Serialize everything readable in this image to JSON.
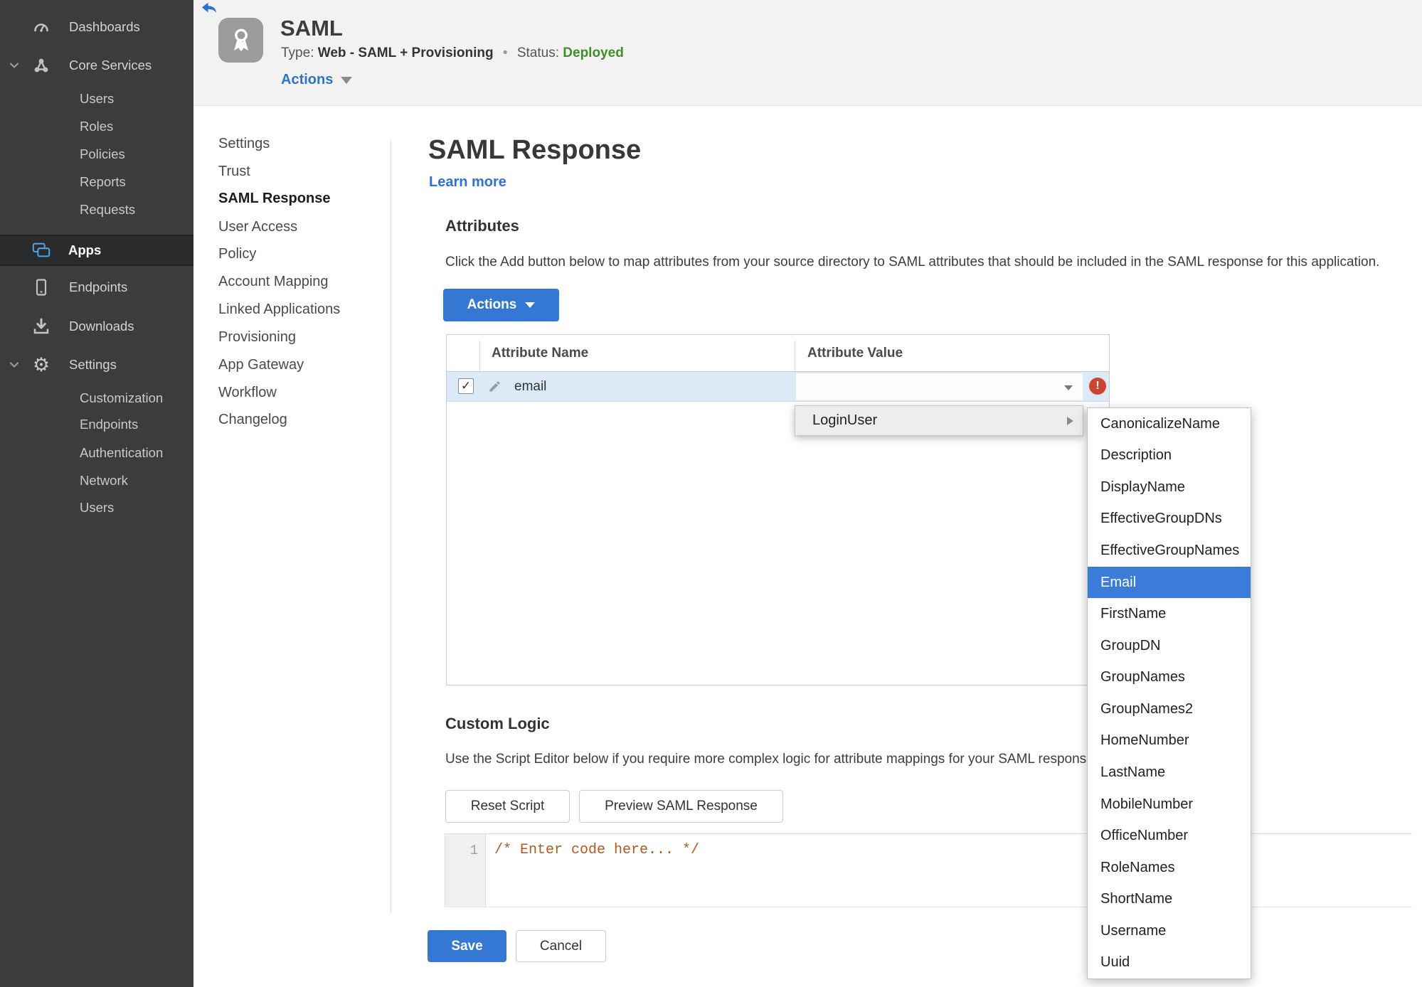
{
  "colors": {
    "accent_blue": "#3478d3",
    "link_blue": "#2e71d8",
    "status_green": "#3f8e27",
    "error_red": "#cb4532",
    "menu_highlight_blue": "#3b7cd9",
    "selected_row_blue": "#dce9f7",
    "sidebar_bg": "#3b3c3d",
    "code_comment_orange": "#b05a20",
    "apps_icon_blue": "#4da3e8"
  },
  "icons": {
    "gear": "⚙",
    "checkmark": "✓",
    "error_mark": "!"
  },
  "sidebar": {
    "items": [
      {
        "label": "Dashboards",
        "icon": "gauge-icon"
      },
      {
        "label": "Core Services",
        "icon": "network-icon",
        "expanded": true
      },
      {
        "label": "Users"
      },
      {
        "label": "Roles"
      },
      {
        "label": "Policies"
      },
      {
        "label": "Reports"
      },
      {
        "label": "Requests"
      },
      {
        "label": "Apps",
        "icon": "apps-icon",
        "active": true
      },
      {
        "label": "Endpoints",
        "icon": "tablet-icon"
      },
      {
        "label": "Downloads",
        "icon": "download-icon"
      },
      {
        "label": "Settings",
        "icon": "gear-icon",
        "expanded": true
      },
      {
        "label": "Customization"
      },
      {
        "label": "Endpoints"
      },
      {
        "label": "Authentication"
      },
      {
        "label": "Network"
      },
      {
        "label": "Users"
      }
    ]
  },
  "header": {
    "app_title": "SAML",
    "type_label": "Type:",
    "type_value": "Web - SAML + Provisioning",
    "bullet": "•",
    "status_label": "Status:",
    "status_value": "Deployed",
    "actions_label": "Actions"
  },
  "subnav": {
    "items": [
      {
        "label": "Settings"
      },
      {
        "label": "Trust"
      },
      {
        "label": "SAML Response",
        "active": true
      },
      {
        "label": "User Access"
      },
      {
        "label": "Policy"
      },
      {
        "label": "Account Mapping"
      },
      {
        "label": "Linked Applications"
      },
      {
        "label": "Provisioning"
      },
      {
        "label": "App Gateway"
      },
      {
        "label": "Workflow"
      },
      {
        "label": "Changelog"
      }
    ]
  },
  "main": {
    "title": "SAML Response",
    "learn_more": "Learn more",
    "attributes": {
      "heading": "Attributes",
      "description": "Click the Add button below to map attributes from your source directory to SAML attributes that should be included in the SAML response for this application.",
      "actions_button": "Actions"
    },
    "table": {
      "columns": [
        "Attribute Name",
        "Attribute Value"
      ],
      "rows": [
        {
          "name": "email",
          "checked": true,
          "value": ""
        }
      ]
    },
    "context_menu": {
      "label": "LoginUser"
    },
    "submenu": {
      "selected": "Email",
      "items": [
        "CanonicalizeName",
        "Description",
        "DisplayName",
        "EffectiveGroupDNs",
        "EffectiveGroupNames",
        "Email",
        "FirstName",
        "GroupDN",
        "GroupNames",
        "GroupNames2",
        "HomeNumber",
        "LastName",
        "MobileNumber",
        "OfficeNumber",
        "RoleNames",
        "ShortName",
        "Username",
        "Uuid"
      ]
    },
    "custom_logic": {
      "heading": "Custom Logic",
      "description": "Use the Script Editor below if you require more complex logic for attribute mappings for your SAML response.",
      "reset_button": "Reset Script",
      "preview_button": "Preview SAML Response",
      "editor": {
        "line_number": "1",
        "code": "/* Enter code here... */"
      }
    },
    "footer": {
      "save": "Save",
      "cancel": "Cancel"
    }
  }
}
